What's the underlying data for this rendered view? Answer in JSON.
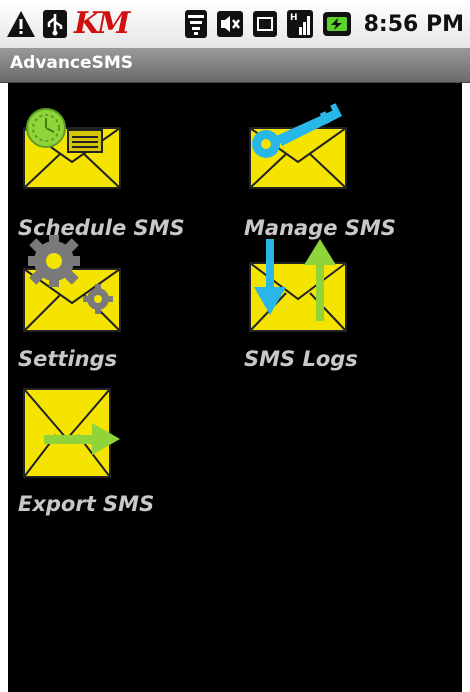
{
  "status_bar": {
    "time": "8:56 PM",
    "icons": [
      "warning-icon",
      "usb-icon",
      "km-logo",
      "wifi-icon",
      "mute-icon",
      "sd-card-icon",
      "signal-icon",
      "battery-charging-icon"
    ],
    "km_text": "KM"
  },
  "app_bar": {
    "title": "AdvanceSMS"
  },
  "menu": {
    "items": [
      {
        "label": "Schedule SMS",
        "icon": "schedule-sms-icon"
      },
      {
        "label": "Manage SMS",
        "icon": "manage-sms-icon"
      },
      {
        "label": "Settings",
        "icon": "settings-icon"
      },
      {
        "label": "SMS Logs",
        "icon": "sms-logs-icon"
      },
      {
        "label": "Export SMS",
        "icon": "export-sms-icon"
      }
    ]
  },
  "colors": {
    "envelope": "#f5e400",
    "background": "#000000",
    "label": "#c8c8c8",
    "accent_green": "#8fd43a",
    "accent_blue": "#29b6e8",
    "gear_gray": "#7a7a7a"
  }
}
